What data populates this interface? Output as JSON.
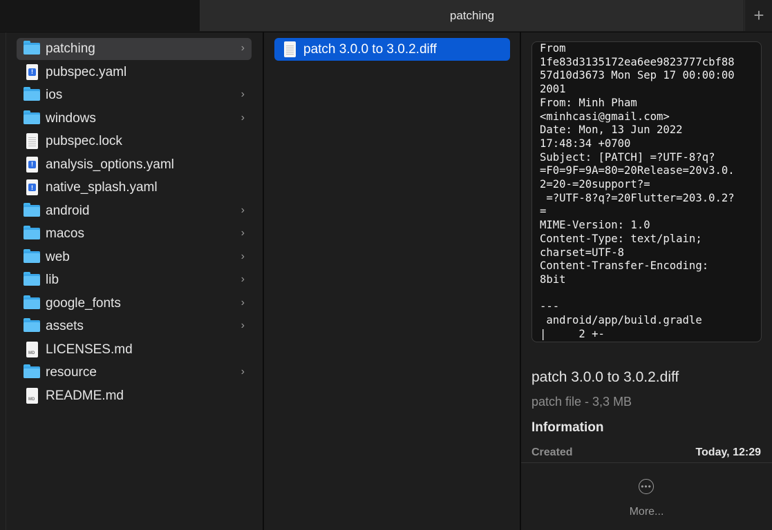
{
  "window": {
    "tab_title": "patching",
    "add_tab_glyph": "+"
  },
  "icons": {
    "folder": "folder-icon",
    "yaml": "yaml-file-icon",
    "lock": "document-icon",
    "md": "markdown-file-icon",
    "chevron": "chevron-right-icon",
    "more": "ellipsis-circle-icon"
  },
  "colors": {
    "selection": "#0a5ad4",
    "folder": "#3aa6e8",
    "yaml_badge": "#2f6fe4"
  },
  "files": [
    {
      "label": "patching",
      "kind": "folder"
    },
    {
      "label": "pubspec.yaml",
      "kind": "yaml"
    },
    {
      "label": "ios",
      "kind": "folder"
    },
    {
      "label": "windows",
      "kind": "folder"
    },
    {
      "label": "pubspec.lock",
      "kind": "lock"
    },
    {
      "label": "analysis_options.yaml",
      "kind": "yaml"
    },
    {
      "label": "native_splash.yaml",
      "kind": "yaml"
    },
    {
      "label": "android",
      "kind": "folder"
    },
    {
      "label": "macos",
      "kind": "folder"
    },
    {
      "label": "web",
      "kind": "folder"
    },
    {
      "label": "lib",
      "kind": "folder"
    },
    {
      "label": "google_fonts",
      "kind": "folder"
    },
    {
      "label": "assets",
      "kind": "folder"
    },
    {
      "label": "LICENSES.md",
      "kind": "md"
    },
    {
      "label": "resource",
      "kind": "folder"
    },
    {
      "label": "README.md",
      "kind": "md"
    }
  ],
  "column2": {
    "items": [
      {
        "label": "patch 3.0.0 to 3.0.2.diff"
      }
    ]
  },
  "preview": {
    "content": "From\n1fe83d3135172ea6ee9823777cbf88\n57d10d3673 Mon Sep 17 00:00:00\n2001\nFrom: Minh Pham\n<minhcasi@gmail.com>\nDate: Mon, 13 Jun 2022\n17:48:34 +0700\nSubject: [PATCH] =?UTF-8?q?\n=F0=9F=9A=80=20Release=20v3.0.\n2=20-=20support?=\n =?UTF-8?q?=20Flutter=203.0.2?\n=\nMIME-Version: 1.0\nContent-Type: text/plain;\ncharset=UTF-8\nContent-Transfer-Encoding:\n8bit\n\n---\n android/app/build.gradle\n|     2 +-",
    "file_name": "patch 3.0.0 to 3.0.2.diff",
    "file_type": "patch file - 3,3 MB",
    "info_heading": "Information",
    "created_label": "Created",
    "created_value": "Today, 12:29",
    "more_label": "More..."
  }
}
